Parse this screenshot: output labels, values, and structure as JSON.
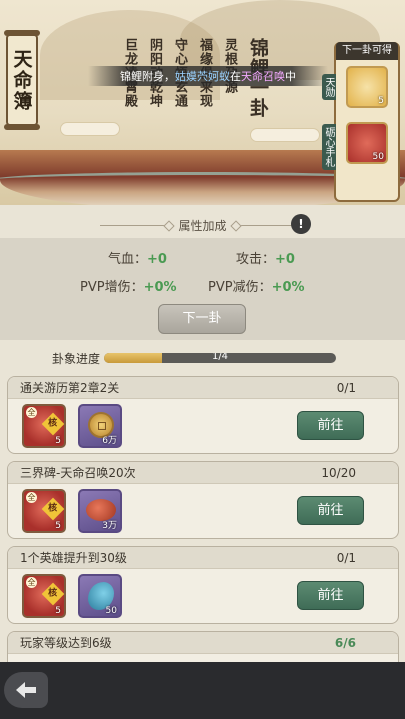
{
  "banner": {
    "title": "天命簿",
    "poem_lines": [
      "锦鲤一卦",
      "灵根孕源",
      "福缘俱来现",
      "守心悟玄通",
      "阴阳动乾坤",
      "巨龙凌霄殿"
    ],
    "notice": {
      "prefix": "锦鲤附身，",
      "name": "姑嫫茓妸蚁",
      "mid": "在",
      "location": "天命召唤",
      "suffix": "中"
    },
    "next_reward": {
      "title": "下一卦可得",
      "tag_top": "天勋",
      "tag_bottom": "砺心手札",
      "items": [
        {
          "icon": "fruit-icon",
          "count": "5"
        },
        {
          "icon": "skill-book-icon",
          "count": "50"
        }
      ]
    }
  },
  "attributes": {
    "header": "属性加成",
    "info_label": "!",
    "stats": [
      {
        "label": "气血：",
        "value": "+0"
      },
      {
        "label": "攻击：",
        "value": "+0"
      },
      {
        "label": "PVP增伤：",
        "value": "+0%"
      },
      {
        "label": "PVP减伤：",
        "value": "+0%"
      }
    ],
    "next_button": "下一卦"
  },
  "progress": {
    "label": "卦象进度",
    "text": "1/4",
    "fraction": 0.25
  },
  "tasks": [
    {
      "title": "通关游历第2章2关",
      "count": "0/1",
      "done": false,
      "button": "前往",
      "rewards": [
        {
          "icon": "skill-book-icon",
          "badge": "全",
          "tag": "核",
          "qty": "5"
        },
        {
          "icon": "copper-coin-icon",
          "qty": "6万"
        }
      ]
    },
    {
      "title": "三界碑-天命召唤20次",
      "count": "10/20",
      "done": false,
      "button": "前往",
      "rewards": [
        {
          "icon": "skill-book-icon",
          "badge": "全",
          "tag": "核",
          "qty": "5"
        },
        {
          "icon": "meat-icon",
          "qty": "3万"
        }
      ]
    },
    {
      "title": "1个英雄提升到30级",
      "count": "0/1",
      "done": false,
      "button": "前往",
      "rewards": [
        {
          "icon": "skill-book-icon",
          "badge": "全",
          "tag": "核",
          "qty": "5"
        },
        {
          "icon": "spirit-fish-icon",
          "qty": "50"
        }
      ]
    },
    {
      "title": "玩家等级达到6级",
      "count": "6/6",
      "done": true
    }
  ],
  "colors": {
    "accent_green": "#4a8a58",
    "button_green": "#3f6c57",
    "progress_gold": "#c89a3a"
  }
}
